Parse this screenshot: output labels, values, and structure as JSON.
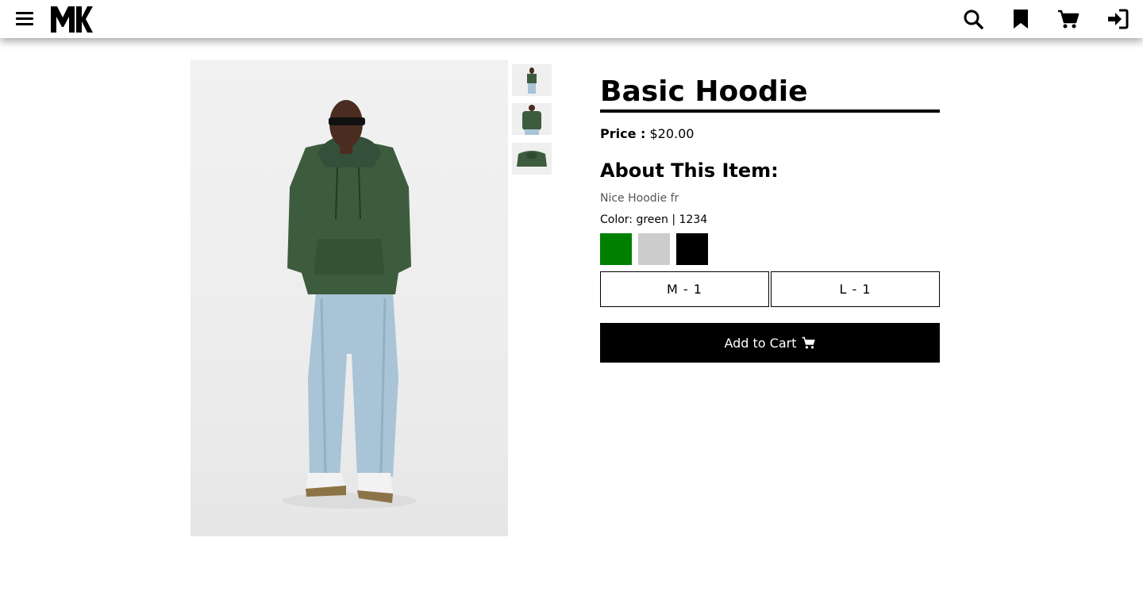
{
  "header": {
    "menu_icon": "hamburger-icon",
    "logo_text": "MK",
    "icons": [
      "search-icon",
      "bookmark-icon",
      "cart-icon",
      "sign-in-icon"
    ]
  },
  "product": {
    "title": "Basic Hoodie",
    "price_label": "Price :",
    "price_value": "$20.00",
    "about_heading": "About This Item:",
    "description": "Nice Hoodie fr",
    "color_label": "Color: green | 1234",
    "swatches": [
      {
        "name": "green",
        "hex": "#008000"
      },
      {
        "name": "light-gray",
        "hex": "#cccccc"
      },
      {
        "name": "black",
        "hex": "#000000"
      }
    ],
    "sizes": [
      "M - 1",
      "L - 1"
    ],
    "add_to_cart_label": "Add to Cart"
  },
  "colors": {
    "hoodie": "#3d5c3d",
    "jeans": "#a9c4d6",
    "accent": "#000000"
  }
}
